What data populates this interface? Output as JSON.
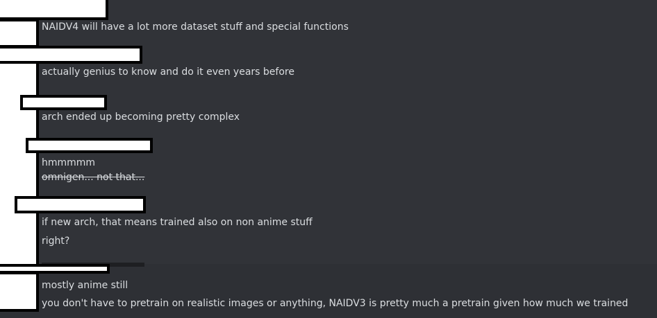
{
  "messages": {
    "m1": "NAIDV4 will have a lot more dataset stuff and special functions",
    "m2": "actually genius to know and do it even years before",
    "m3": "arch ended up becoming pretty complex",
    "m4a": "hmmmmm",
    "m4b": "omnigen... not that...",
    "m5a": "if new arch, that means trained also on non anime stuff",
    "m5b": "right?",
    "m6a": "mostly anime still",
    "m6b": "you don't have to pretrain on realistic images or anything, NAIDV3 is pretty much a pretrain given how much we trained"
  }
}
